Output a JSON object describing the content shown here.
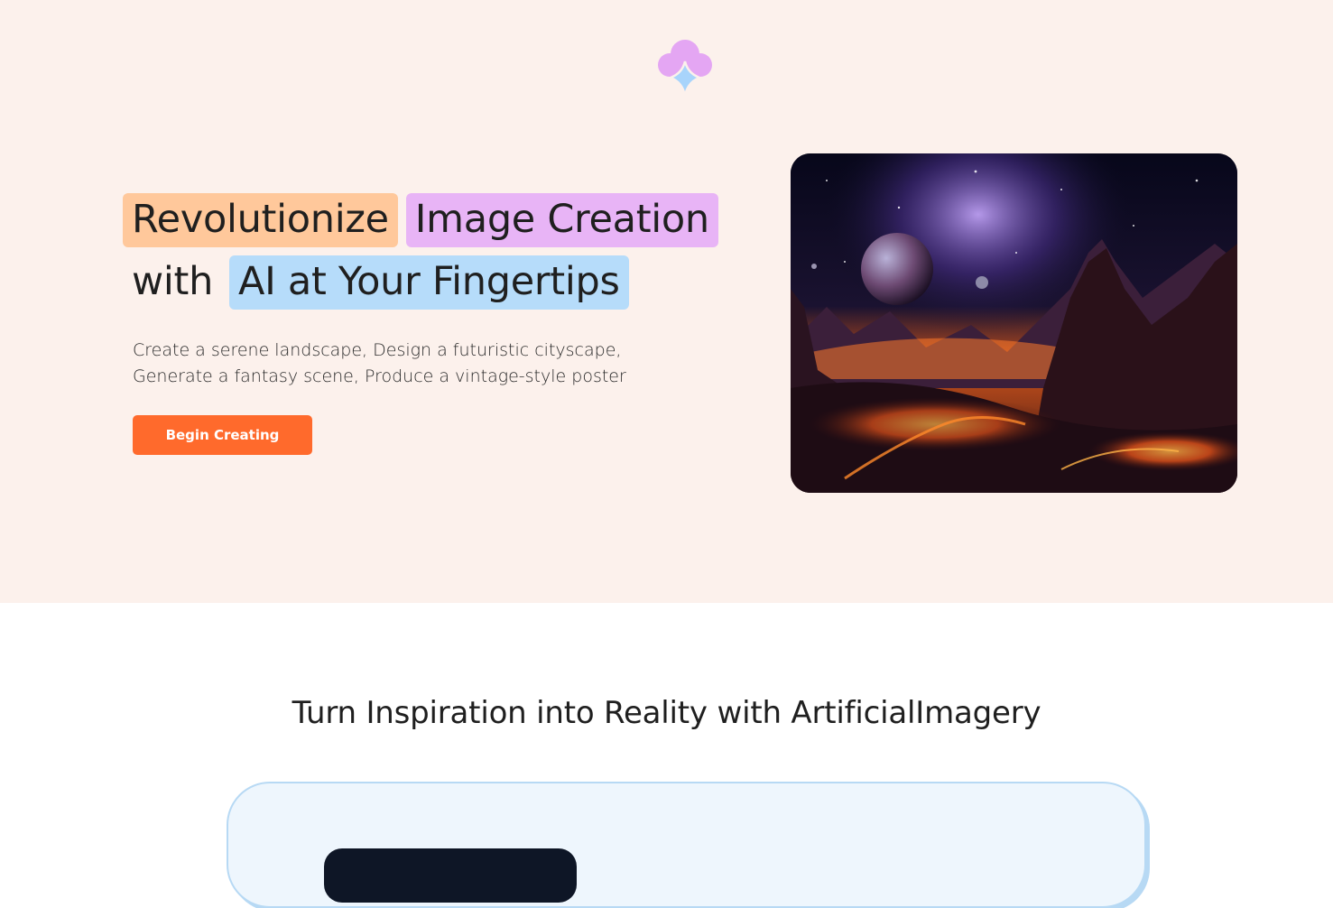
{
  "logo": {
    "icon": "cloud-sparkle-icon",
    "colors": {
      "cloud": "#e4a6f3",
      "sparkle": "#a8d4fb"
    }
  },
  "hero": {
    "headline": {
      "part1": "Revolutionize",
      "part2": "Image Creation",
      "part3": "with",
      "part4": "AI at Your Fingertips"
    },
    "subtitle_line1": "Create a serene landscape, Design a futuristic cityscape,",
    "subtitle_line2": "Generate a fantasy scene, Produce a vintage-style poster",
    "cta_label": "Begin Creating",
    "image": {
      "description_icon": "space-landscape-image"
    }
  },
  "section": {
    "title": "Turn Inspiration into Reality with ArtificialImagery"
  },
  "colors": {
    "hero_bg": "#fcf1ec",
    "accent": "#ff6a2c",
    "chip_orange": "#ffc89b",
    "chip_purple": "#e8b4f6",
    "chip_blue": "#b6dcfa",
    "card_bg": "#eef6fd",
    "card_border": "#b7d9f4"
  }
}
